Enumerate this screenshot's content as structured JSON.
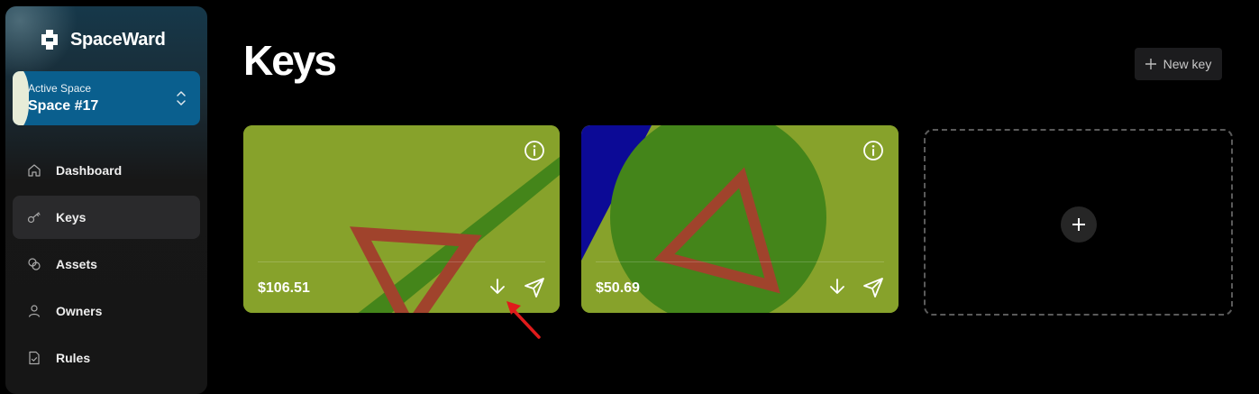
{
  "brand": {
    "name": "SpaceWard"
  },
  "active_space": {
    "label": "Active Space",
    "name": "Space #17"
  },
  "nav": {
    "items": [
      {
        "label": "Dashboard",
        "icon": "home-icon",
        "active": false
      },
      {
        "label": "Keys",
        "icon": "key-icon",
        "active": true
      },
      {
        "label": "Assets",
        "icon": "coins-icon",
        "active": false
      },
      {
        "label": "Owners",
        "icon": "user-icon",
        "active": false
      },
      {
        "label": "Rules",
        "icon": "file-check-icon",
        "active": false
      }
    ]
  },
  "main": {
    "title": "Keys",
    "new_key_label": "New key"
  },
  "keys": [
    {
      "balance": "$106.51",
      "background": "#87a22b"
    },
    {
      "balance": "$50.69",
      "background": "#87a22b"
    }
  ],
  "colors": {
    "accent_blue": "#0a5f8e",
    "card_green": "#87a22b",
    "stripe_green": "#44851a",
    "triangle_red": "#a0432c",
    "annotation_red": "#e01b1b"
  }
}
